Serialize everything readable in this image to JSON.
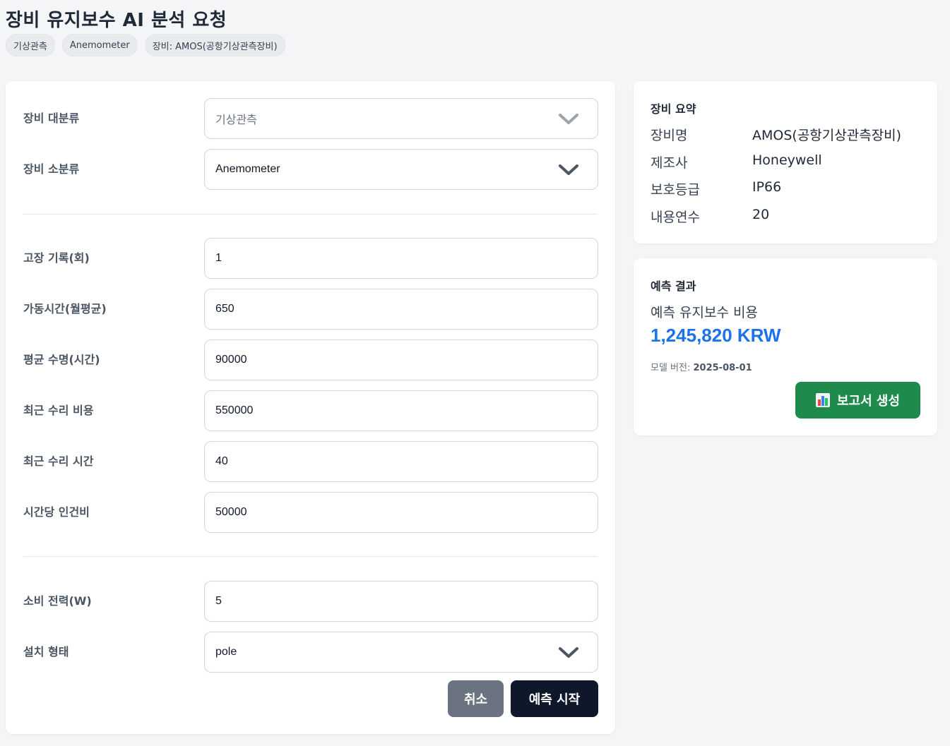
{
  "header": {
    "title": "장비 유지보수 AI 분석 요청",
    "chips": [
      "기상관측",
      "Anemometer",
      "장비: AMOS(공항기상관측장비)"
    ]
  },
  "form": {
    "major_category": {
      "label": "장비 대분류",
      "value": "기상관측"
    },
    "minor_category": {
      "label": "장비 소분류",
      "value": "Anemometer"
    },
    "failure_count": {
      "label": "고장 기록(회)",
      "value": "1"
    },
    "operating_hours": {
      "label": "가동시간(월평균)",
      "value": "650"
    },
    "mean_life": {
      "label": "평균 수명(시간)",
      "value": "90000"
    },
    "recent_repair_cost": {
      "label": "최근 수리 비용",
      "value": "550000"
    },
    "recent_repair_time": {
      "label": "최근 수리 시간",
      "value": "40"
    },
    "hourly_labor_cost": {
      "label": "시간당 인건비",
      "value": "50000"
    },
    "power_consumption": {
      "label": "소비 전력(W)",
      "value": "5"
    },
    "install_type": {
      "label": "설치 형태",
      "value": "pole"
    },
    "cancel_label": "취소",
    "start_label": "예측 시작"
  },
  "summary": {
    "title": "장비 요약",
    "rows": [
      {
        "key": "장비명",
        "value": "AMOS(공항기상관측장비)"
      },
      {
        "key": "제조사",
        "value": "Honeywell"
      },
      {
        "key": "보호등급",
        "value": "IP66"
      },
      {
        "key": "내용연수",
        "value": "20"
      }
    ]
  },
  "result": {
    "title": "예측 결과",
    "label": "예측 유지보수 비용",
    "value": "1,245,820 KRW",
    "model_version_label": "모델 버전:",
    "model_version": "2025-08-01",
    "report_button": "보고서 생성"
  },
  "icons": {
    "select_chevron": "chevron-down-icon",
    "report": "bar-chart-icon"
  },
  "colors": {
    "accent_blue": "#1d72e8",
    "report_green": "#1e8a4c",
    "start_dark": "#0f172a",
    "cancel_gray": "#6b7280"
  }
}
